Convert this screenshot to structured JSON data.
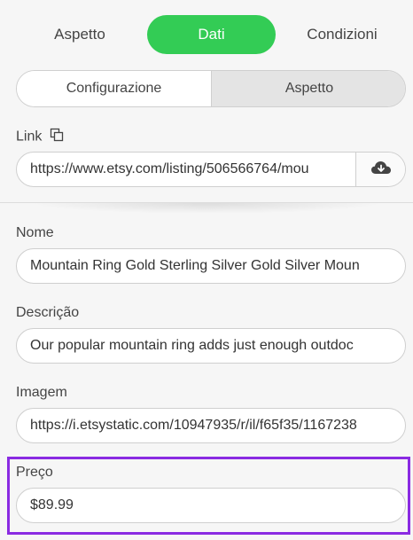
{
  "tabs": [
    {
      "label": "Aspetto"
    },
    {
      "label": "Dati",
      "active": true
    },
    {
      "label": "Condizioni"
    }
  ],
  "segmented": [
    {
      "label": "Configurazione"
    },
    {
      "label": "Aspetto",
      "selected": true
    }
  ],
  "link": {
    "label": "Link",
    "value": "https://www.etsy.com/listing/506566764/mou",
    "icon": "copy-link-icon",
    "action_icon": "cloud-download-icon"
  },
  "fields": {
    "nome": {
      "label": "Nome",
      "value": "Mountain Ring Gold Sterling Silver Gold Silver Moun"
    },
    "descricao": {
      "label": "Descrição",
      "value": "Our popular mountain ring adds just enough outdoc"
    },
    "imagem": {
      "label": "Imagem",
      "value": "https://i.etsystatic.com/10947935/r/il/f65f35/1167238"
    },
    "preco": {
      "label": "Preço",
      "value": "$89.99"
    }
  },
  "colors": {
    "active_tab": "#33cc55",
    "highlight": "#8a2be2"
  }
}
